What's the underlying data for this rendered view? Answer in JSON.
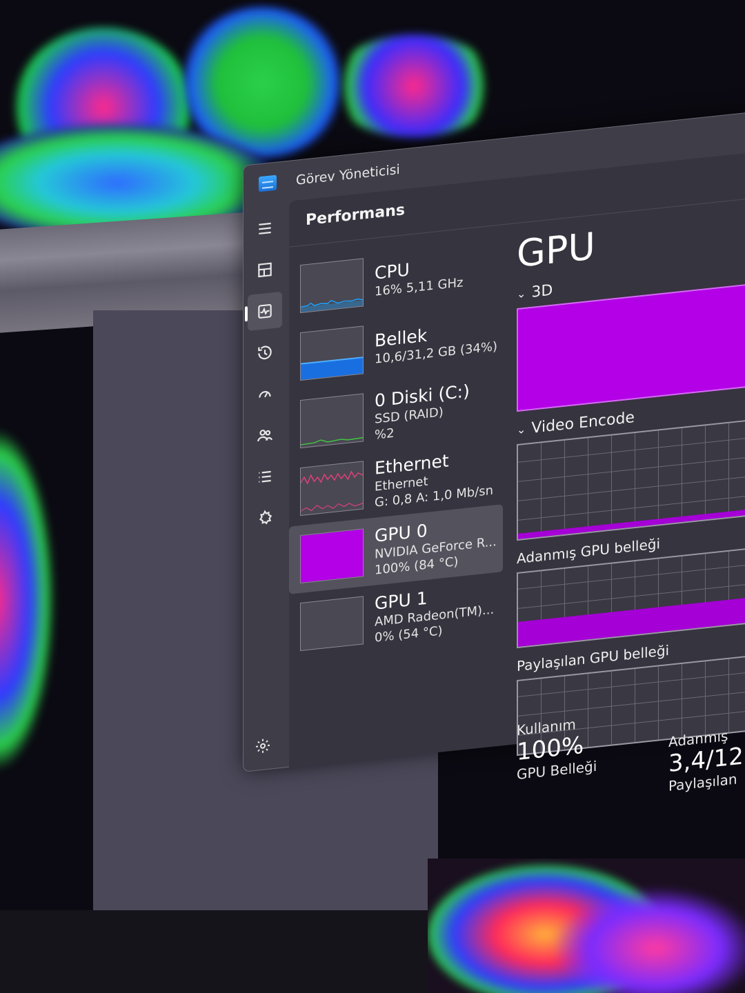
{
  "window": {
    "title": "Görev Yöneticisi",
    "page_title": "Performans"
  },
  "nav": [
    {
      "icon": "hamburger-icon"
    },
    {
      "icon": "processes-icon"
    },
    {
      "icon": "performance-icon",
      "active": true
    },
    {
      "icon": "history-icon"
    },
    {
      "icon": "startup-icon"
    },
    {
      "icon": "users-icon"
    },
    {
      "icon": "details-icon"
    },
    {
      "icon": "services-icon"
    }
  ],
  "devices": [
    {
      "name": "CPU",
      "lines": [
        "16%  5,11 GHz"
      ],
      "color": "#1aa3ff"
    },
    {
      "name": "Bellek",
      "lines": [
        "10,6/31,2 GB (34%)"
      ],
      "color": "#1a6fe0"
    },
    {
      "name": "0 Diski (C:)",
      "lines": [
        "SSD (RAID)",
        "%2"
      ],
      "color": "#3fc93f"
    },
    {
      "name": "Ethernet",
      "lines": [
        "Ethernet",
        "G: 0,8  A: 1,0 Mb/sn"
      ],
      "color": "#e0407a"
    },
    {
      "name": "GPU 0",
      "lines": [
        "NVIDIA GeForce R...",
        "100%  (84 °C)"
      ],
      "color": "#b300e6",
      "selected": true
    },
    {
      "name": "GPU 1",
      "lines": [
        "AMD Radeon(TM)...",
        "0%  (54 °C)"
      ],
      "color": "#9c9aa6"
    }
  ],
  "detail": {
    "title": "GPU",
    "engine1": "3D",
    "engine2": "Video Encode",
    "dedicated_label": "Adanmış GPU belleği",
    "shared_label": "Paylaşılan GPU belleği",
    "usage_label": "Kullanım",
    "usage_value": "100%",
    "gpu_memory_label": "GPU Belleği",
    "dedicated_stat_label": "Adanmış",
    "dedicated_stat_value": "3,4/12",
    "shared_stat_label": "Paylaşılan"
  },
  "colors": {
    "gpu_accent": "#b300e6",
    "window_bg": "#3f3d48"
  }
}
